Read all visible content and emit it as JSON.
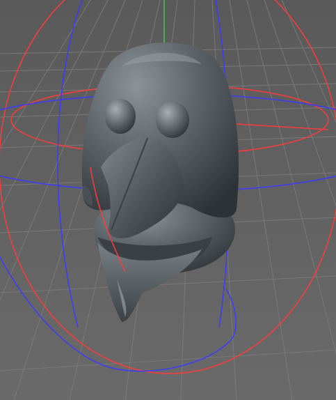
{
  "viewport": {
    "background": "#5e5e5e",
    "grid_color": "#777777",
    "object": {
      "name": "bird-head-model",
      "color": "#5f666b"
    },
    "rotate_gizmo": {
      "x_axis_color": "#ff3b3b",
      "y_axis_color": "#3b3bff",
      "up_axis_color": "#3bd13b"
    }
  }
}
